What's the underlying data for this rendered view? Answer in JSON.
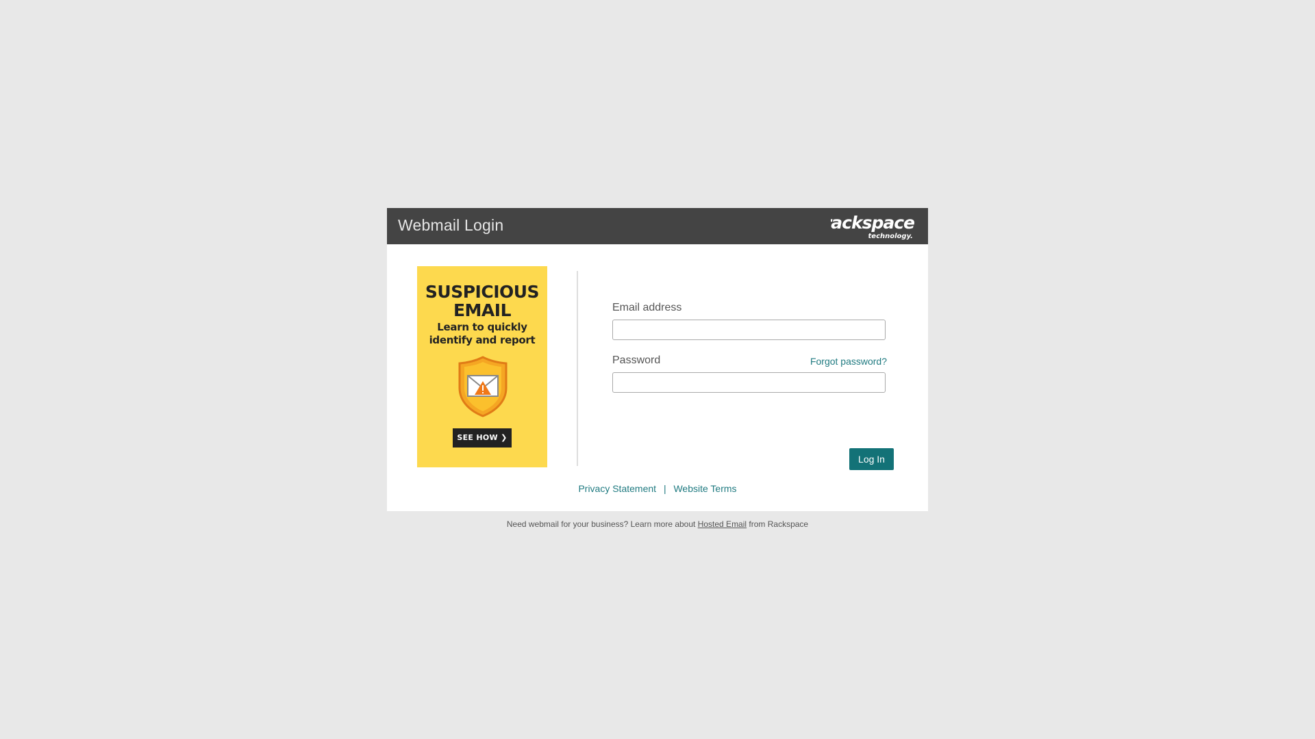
{
  "header": {
    "title": "Webmail Login",
    "brand_name": "rackspace",
    "brand_tagline": "technology."
  },
  "ad": {
    "headline_line1": "SUSPICIOUS",
    "headline_line2": "EMAIL",
    "sub_line1": "Learn to quickly",
    "sub_line2": "identify and report",
    "cta_label": "SEE HOW",
    "cta_icon": "chevron-right-icon",
    "icon": "shield-envelope-warning-icon",
    "background_color": "#fdd94e"
  },
  "form": {
    "email_label": "Email address",
    "email_value": "",
    "password_label": "Password",
    "password_value": "",
    "forgot_label": "Forgot password?",
    "login_label": "Log In"
  },
  "footer": {
    "privacy_label": "Privacy Statement",
    "separator": "|",
    "terms_label": "Website Terms"
  },
  "promo": {
    "text_before": "Need webmail for your business? Learn more about ",
    "link_label": "Hosted Email",
    "text_after": " from Rackspace"
  },
  "colors": {
    "page_background": "#e8e8e8",
    "header_background": "#444444",
    "accent": "#137277",
    "link": "#1f7a80"
  }
}
